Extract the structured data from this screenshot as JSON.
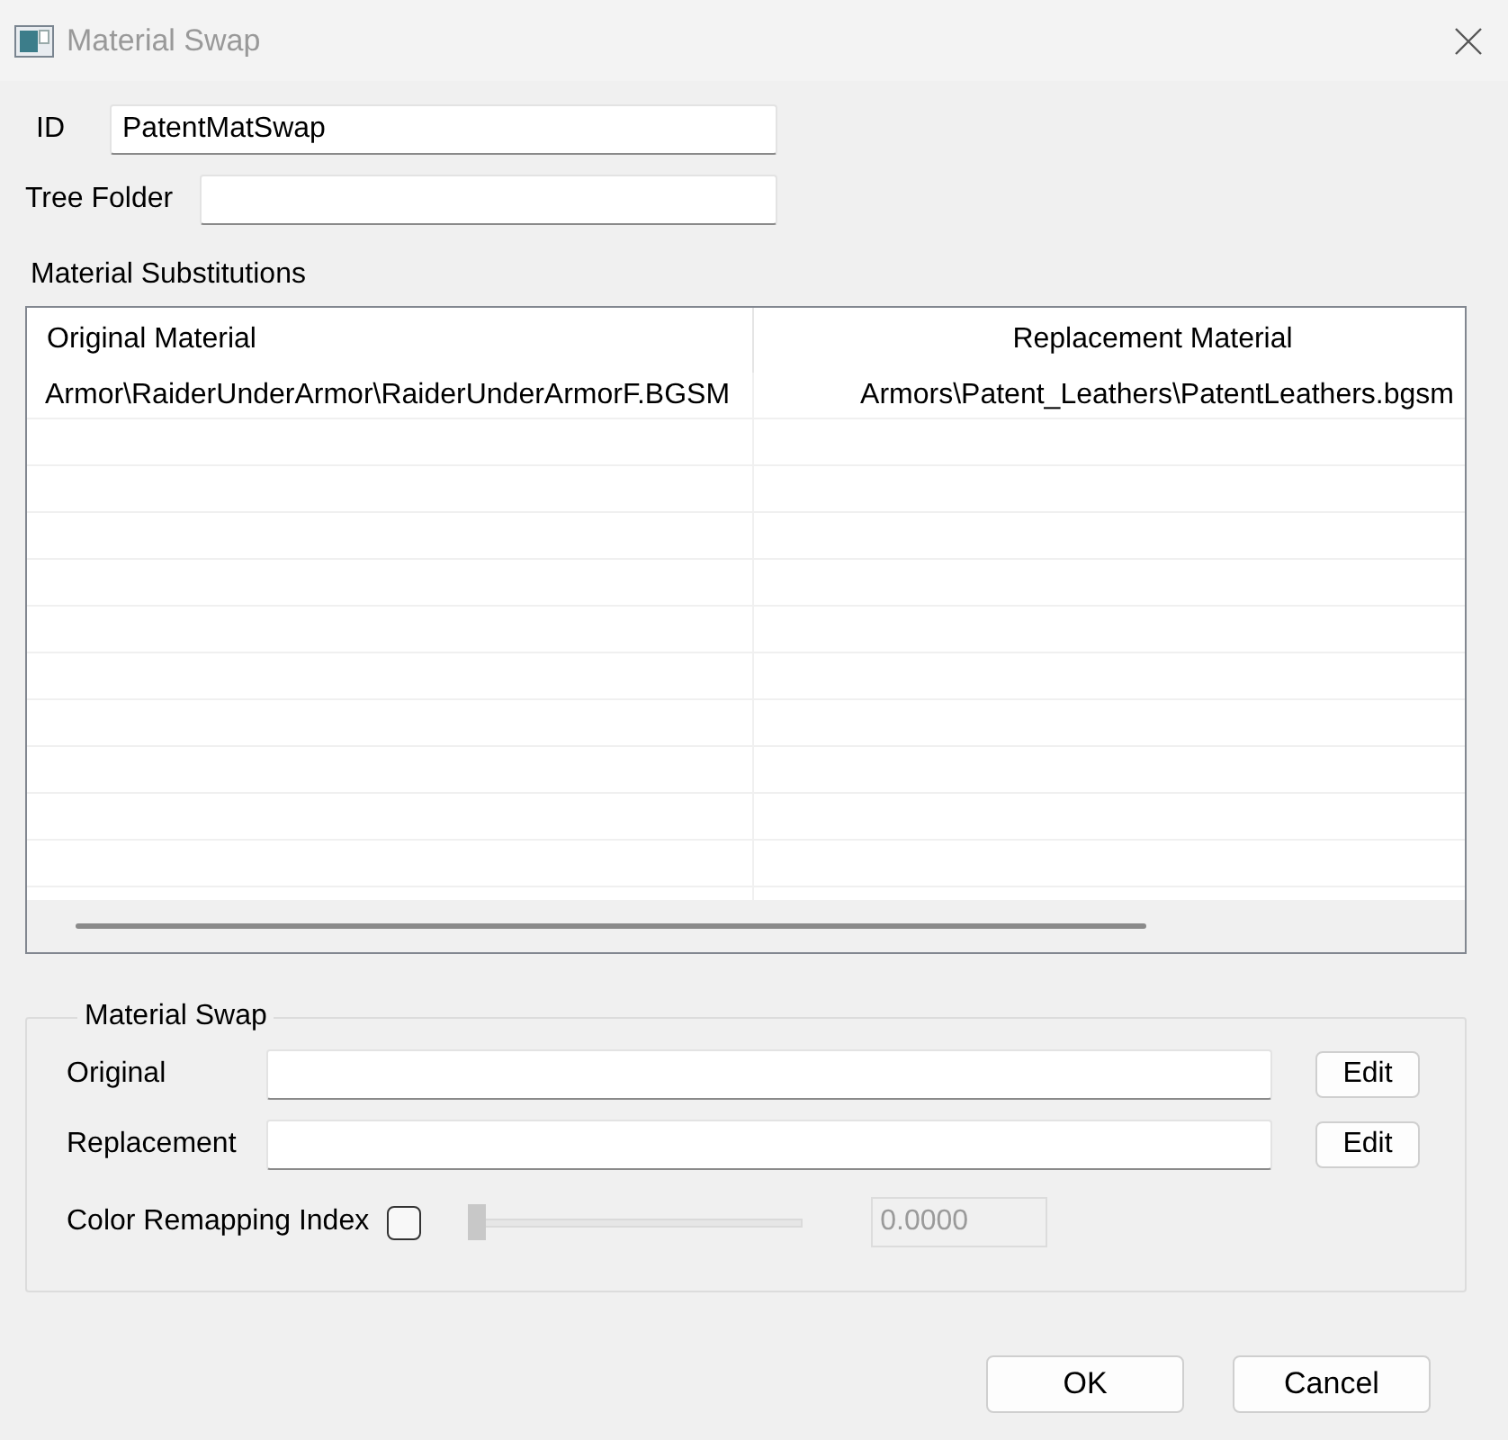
{
  "window": {
    "title": "Material Swap"
  },
  "fields": [
    {
      "label": "ID",
      "value": "PatentMatSwap"
    },
    {
      "label": "Tree Folder"
    }
  ],
  "substitutions": {
    "title": "Material Substitutions",
    "columns": [
      "Original Material",
      "Replacement Material"
    ],
    "rows": [
      [
        "Armor\\RaiderUnderArmor\\RaiderUnderArmorF.BGSM",
        "Armors\\Patent_Leathers\\PatentLeathers.bgsm"
      ]
    ]
  },
  "material_swap": {
    "title": "Material Swap",
    "fields": [
      {
        "label": "Original",
        "button": "Edit"
      },
      {
        "label": "Replacement",
        "button": "Edit"
      }
    ],
    "color_remap": {
      "label": "Color Remapping Index",
      "checked": false,
      "level": 0,
      "value": "0.0000",
      "disabled": true
    }
  },
  "buttons": [
    "OK",
    "Cancel"
  ]
}
